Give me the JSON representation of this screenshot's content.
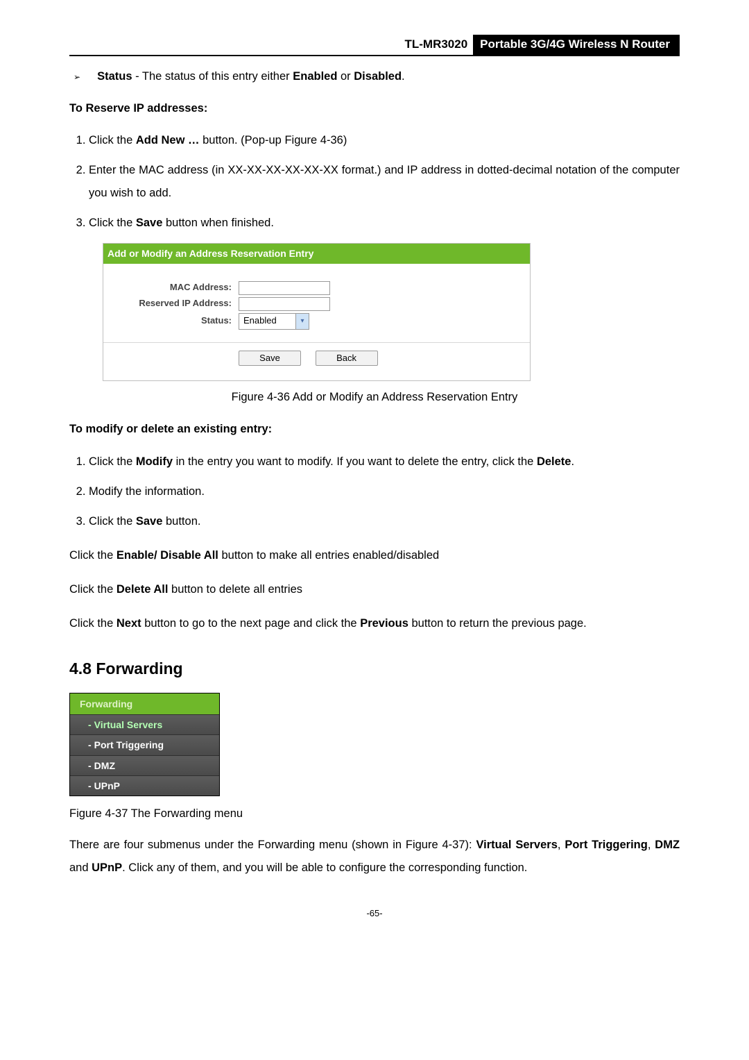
{
  "header": {
    "model": "TL-MR3020",
    "product": "Portable 3G/4G Wireless N Router"
  },
  "status_bullet": {
    "label": "Status",
    "dash": " - ",
    "text1": "The status of this entry either ",
    "enabled": "Enabled",
    "or": " or ",
    "disabled": "Disabled",
    "dot": "."
  },
  "reserve": {
    "title": "To Reserve IP addresses:",
    "steps": {
      "s1_a": "Click the ",
      "s1_b": "Add New …",
      "s1_c": " button. (Pop-up Figure 4-36)",
      "s2": "Enter the MAC address (in XX-XX-XX-XX-XX-XX format.) and IP address in dotted-decimal notation of the computer you wish to add.",
      "s3_a": "Click the ",
      "s3_b": "Save",
      "s3_c": " button when finished."
    }
  },
  "panel": {
    "title": "Add or Modify an Address Reservation Entry",
    "mac_label": "MAC Address:",
    "ip_label": "Reserved IP Address:",
    "status_label": "Status:",
    "status_value": "Enabled",
    "save": "Save",
    "back": "Back"
  },
  "fig36": "Figure 4-36    Add or Modify an Address Reservation Entry",
  "modify": {
    "title": "To modify or delete an existing entry:",
    "s1_a": "Click the ",
    "s1_b": "Modify",
    "s1_c": " in the entry you want to modify. If you want to delete the entry, click the ",
    "s1_d": "Delete",
    "s1_e": ".",
    "s2": "Modify the information.",
    "s3_a": "Click the ",
    "s3_b": "Save",
    "s3_c": " button."
  },
  "paras": {
    "p1_a": "Click the ",
    "p1_b": "Enable/ Disable All",
    "p1_c": " button to make all entries enabled/disabled",
    "p2_a": "Click the ",
    "p2_b": "Delete All",
    "p2_c": " button to delete all entries",
    "p3_a": "Click the ",
    "p3_b": "Next",
    "p3_c": " button to go to the next page and click the ",
    "p3_d": "Previous",
    "p3_e": " button to return the previous page."
  },
  "forwarding": {
    "heading": "4.8  Forwarding",
    "menu_head": "Forwarding",
    "items": [
      "Virtual Servers",
      "Port Triggering",
      "DMZ",
      "UPnP"
    ],
    "fig": "Figure 4-37 The Forwarding menu",
    "p_a": "There are four submenus under the Forwarding menu (shown in Figure 4-37): ",
    "p_b": "Virtual Servers",
    "p_c": ", ",
    "p_d": "Port Triggering",
    "p_e": ", ",
    "p_f": "DMZ",
    "p_g": " and ",
    "p_h": "UPnP",
    "p_i": ". Click any of them, and you will be able to configure the corresponding function."
  },
  "page_number": "-65-"
}
